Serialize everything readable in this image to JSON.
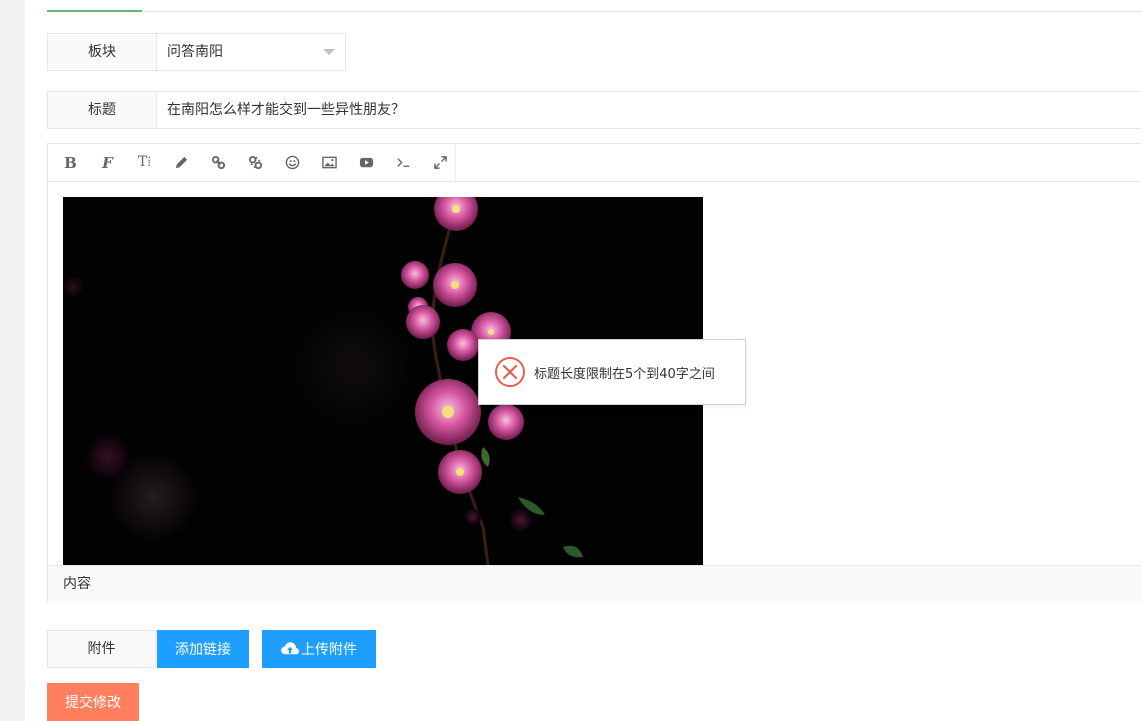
{
  "form": {
    "board_label": "板块",
    "board_value": "问答南阳",
    "title_label": "标题",
    "title_value": "在南阳怎么样才能交到一些异性朋友？",
    "toolbar": {
      "bold": "B",
      "font": "F",
      "text_size": "T⁞"
    },
    "content_label": "内容",
    "attachment_label": "附件",
    "add_link_button": "添加链接",
    "upload_button": "上传附件",
    "submit_button": "提交修改"
  },
  "toast": {
    "message": "标题长度限制在5个到40字之间",
    "icon": "error-circle-icon"
  },
  "colors": {
    "tab_active": "#5fb878",
    "primary_blue": "#1e9fff",
    "submit_orange": "#ff7f5f",
    "error_red": "#e85f4f"
  }
}
